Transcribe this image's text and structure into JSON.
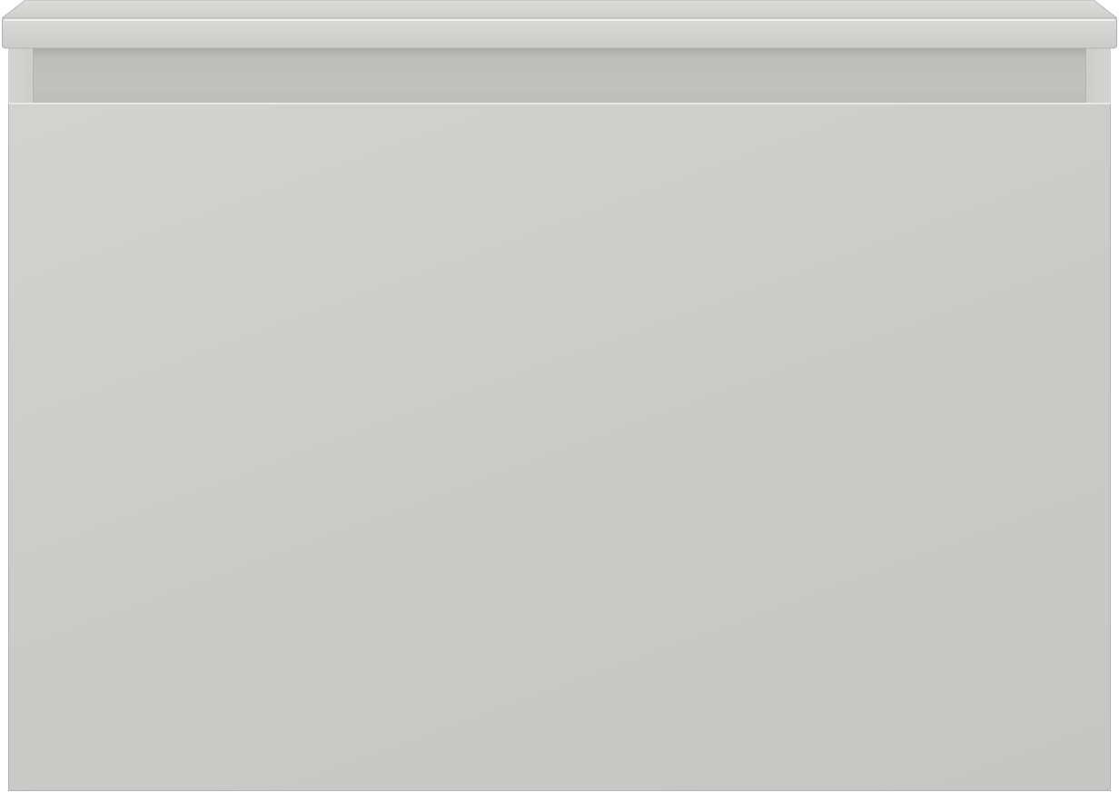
{
  "object": {
    "icon": "vanity-cabinet",
    "colors": {
      "countertop": "#d4d4d2",
      "drawer_front": "#cbcbc9",
      "handle_recess": "#bdbdbb",
      "outline": "#b3b3b1"
    }
  }
}
